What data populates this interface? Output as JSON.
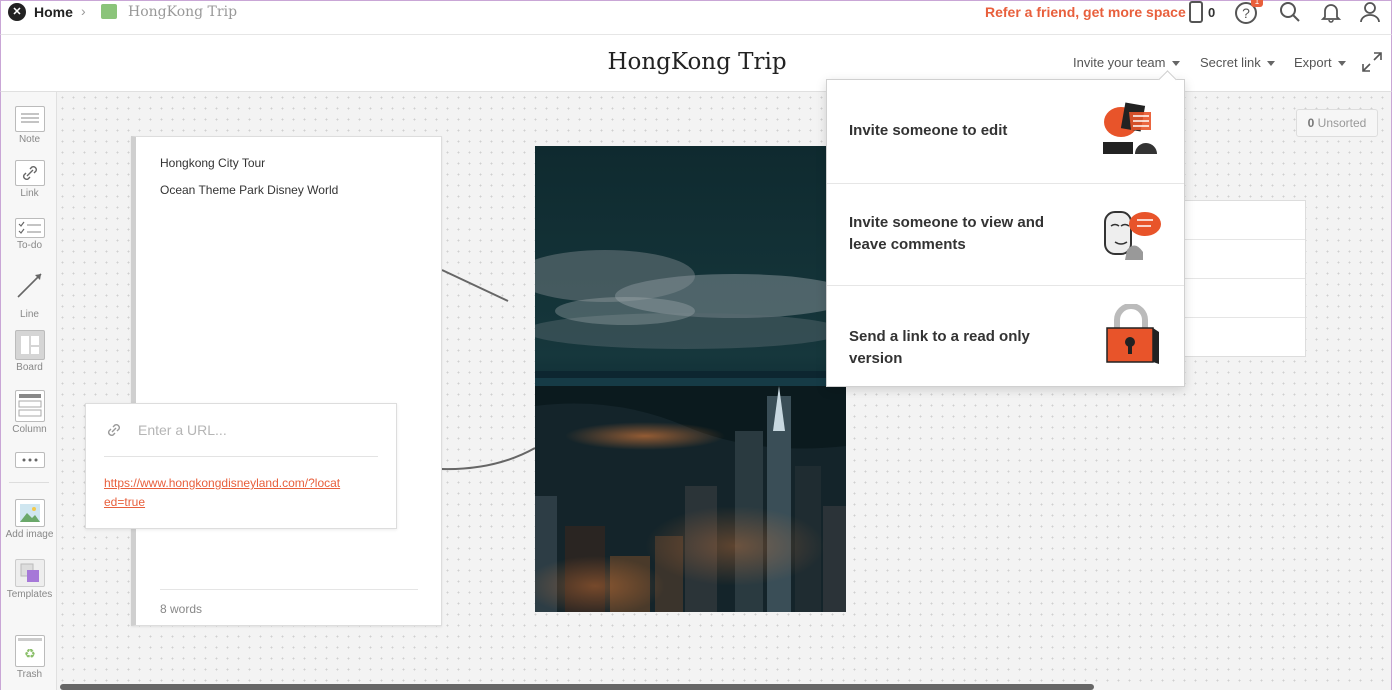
{
  "breadcrumb": {
    "home_label": "Home",
    "separator": "›",
    "board_label": "HongKong Trip",
    "board_color": "#8bc47a"
  },
  "topbar": {
    "refer_label": "Refer a friend, get more space",
    "phone_count": "0",
    "help_badge": "1",
    "accent_color": "#e85f3c"
  },
  "header": {
    "title": "HongKong Trip",
    "invite_label": "Invite your team",
    "secret_link_label": "Secret link",
    "export_label": "Export"
  },
  "sidebar": {
    "items": [
      {
        "label": "Note",
        "icon": "note-icon"
      },
      {
        "label": "Link",
        "icon": "link-icon"
      },
      {
        "label": "To-do",
        "icon": "todo-icon"
      },
      {
        "label": "Line",
        "icon": "line-icon"
      },
      {
        "label": "Board",
        "icon": "board-icon"
      },
      {
        "label": "Column",
        "icon": "column-icon"
      },
      {
        "label": "",
        "icon": "more-icon"
      },
      {
        "label": "Add image",
        "icon": "image-icon"
      },
      {
        "label": "Templates",
        "icon": "templates-icon"
      },
      {
        "label": "Trash",
        "icon": "trash-icon"
      }
    ]
  },
  "note": {
    "lines": [
      "Hongkong City Tour",
      "Ocean Theme Park Disney World"
    ],
    "word_count": "8 words"
  },
  "link_card": {
    "placeholder": "Enter a URL...",
    "url": "https://www.hongkongdisneyland.com/?located=true"
  },
  "unsorted": {
    "count": "0",
    "label": "Unsorted"
  },
  "invite_menu": {
    "items": [
      {
        "label": "Invite someone to edit",
        "icon": "edit-illustration-icon"
      },
      {
        "label": "Invite someone to view and leave comments",
        "icon": "comment-illustration-icon"
      },
      {
        "label": "Send a link to a read only version",
        "icon": "lock-illustration-icon"
      }
    ]
  }
}
